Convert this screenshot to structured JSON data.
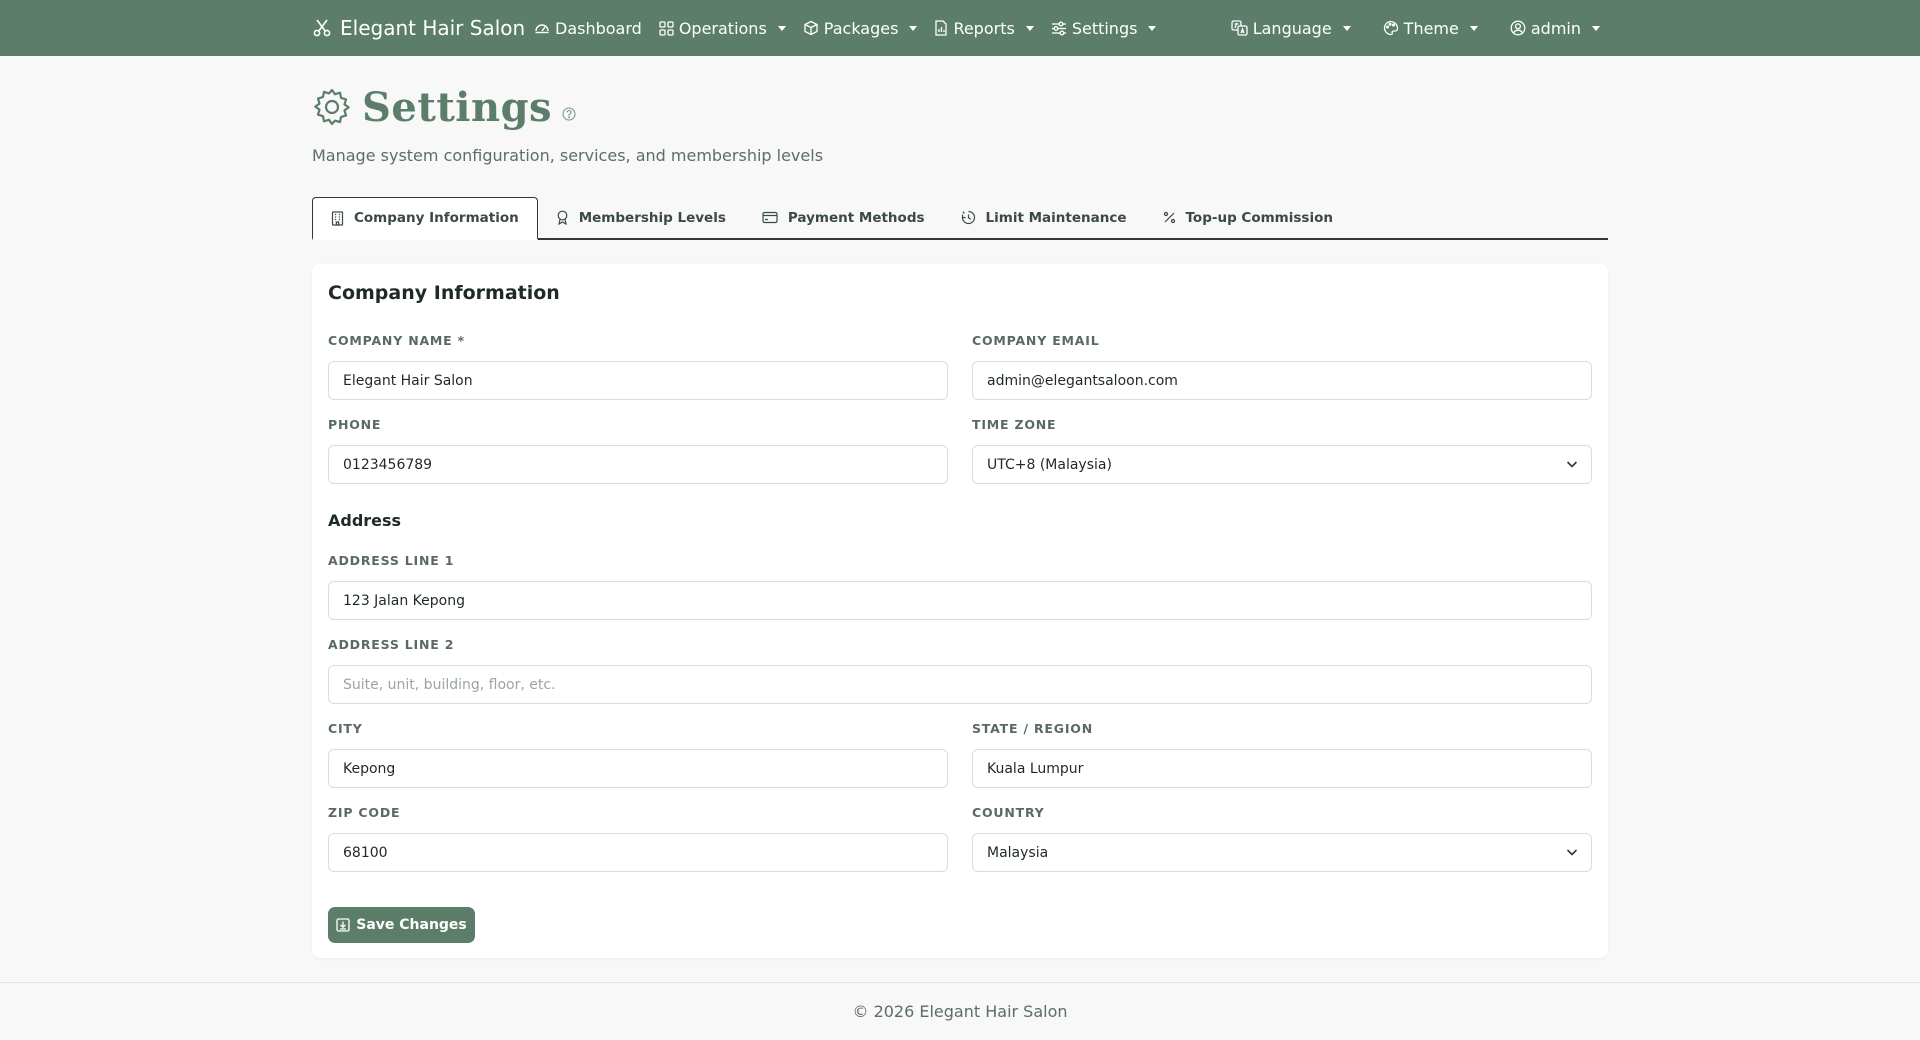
{
  "navbar": {
    "brand": "Elegant Hair Salon",
    "items": [
      {
        "label": "Dashboard",
        "icon": "dashboard-icon",
        "dropdown": false
      },
      {
        "label": "Operations",
        "icon": "grid-icon",
        "dropdown": true
      },
      {
        "label": "Packages",
        "icon": "box-icon",
        "dropdown": true
      },
      {
        "label": "Reports",
        "icon": "report-icon",
        "dropdown": true
      },
      {
        "label": "Settings",
        "icon": "sliders-icon",
        "dropdown": true
      }
    ],
    "right": [
      {
        "label": "Language",
        "icon": "translate-icon"
      },
      {
        "label": "Theme",
        "icon": "palette-icon"
      },
      {
        "label": "admin",
        "icon": "user-circle-icon"
      }
    ],
    "color": "#5b7d6a"
  },
  "header": {
    "title": "Settings",
    "subtitle": "Manage system configuration, services, and membership levels"
  },
  "tabs": [
    {
      "label": "Company Information",
      "icon": "building-icon",
      "active": true
    },
    {
      "label": "Membership Levels",
      "icon": "award-icon",
      "active": false
    },
    {
      "label": "Payment Methods",
      "icon": "credit-card-icon",
      "active": false
    },
    {
      "label": "Limit Maintenance",
      "icon": "clock-history-icon",
      "active": false
    },
    {
      "label": "Top-up Commission",
      "icon": "percent-icon",
      "active": false
    }
  ],
  "form": {
    "title": "Company Information",
    "address_title": "Address",
    "company_name": {
      "label": "COMPANY NAME *",
      "value": "Elegant Hair Salon"
    },
    "company_email": {
      "label": "COMPANY EMAIL",
      "value": "admin@elegantsaloon.com"
    },
    "phone": {
      "label": "PHONE",
      "value": "0123456789"
    },
    "time_zone": {
      "label": "TIME ZONE",
      "value": "UTC+8 (Malaysia)"
    },
    "address1": {
      "label": "ADDRESS LINE 1",
      "value": "123 Jalan Kepong"
    },
    "address2": {
      "label": "ADDRESS LINE 2",
      "value": "",
      "placeholder": "Suite, unit, building, floor, etc."
    },
    "city": {
      "label": "CITY",
      "value": "Kepong"
    },
    "state": {
      "label": "STATE / REGION",
      "value": "Kuala Lumpur"
    },
    "zip": {
      "label": "ZIP CODE",
      "value": "68100"
    },
    "country": {
      "label": "COUNTRY",
      "value": "Malaysia"
    },
    "save_label": "Save Changes"
  },
  "footer": {
    "text": "© 2026 Elegant Hair Salon"
  }
}
